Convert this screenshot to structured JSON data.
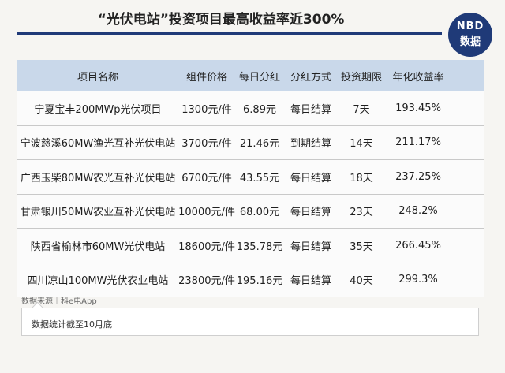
{
  "title": "“光伏电站”投资项目最高收益率近300%",
  "logo": {
    "line1": "NBD",
    "line2": "数据"
  },
  "table": {
    "headers": [
      "项目名称",
      "组件价格",
      "每日分红",
      "分红方式",
      "投资期限",
      "年化收益率"
    ],
    "rows": [
      [
        "宁夏宝丰200MWp光伏项目",
        "1300元/件",
        "6.89元",
        "每日结算",
        "7天",
        "193.45%"
      ],
      [
        "宁波慈溪60MW渔光互补光伏电站",
        "3700元/件",
        "21.46元",
        "到期结算",
        "14天",
        "211.17%"
      ],
      [
        "广西玉柴80MW农光互补光伏电站",
        "6700元/件",
        "43.55元",
        "每日结算",
        "18天",
        "237.25%"
      ],
      [
        "甘肃银川50MW农业互补光伏电站",
        "10000元/件",
        "68.00元",
        "每日结算",
        "23天",
        "248.2%"
      ],
      [
        "陕西省榆林市60MW光伏电站",
        "18600元/件",
        "135.78元",
        "每日结算",
        "35天",
        "266.45%"
      ],
      [
        "四川凉山100MW光伏农业电站",
        "23800元/件",
        "195.16元",
        "每日结算",
        "40天",
        "299.3%"
      ]
    ]
  },
  "source": "数据来源｜科e电App",
  "note": "数据统计截至10月底",
  "colors": {
    "brand": "#1f3a78",
    "header_bg": "#c9d8ea"
  }
}
